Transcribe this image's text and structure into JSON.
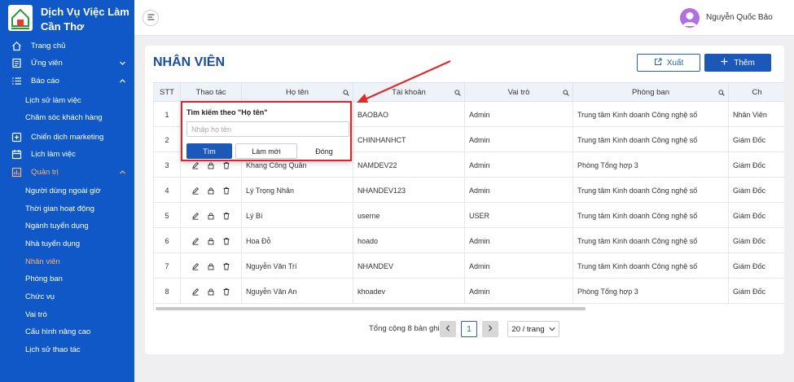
{
  "brand": {
    "name": "Dịch Vụ Việc Làm Cần Thơ"
  },
  "sidebar": {
    "items": [
      {
        "label": "Trang chủ",
        "icon": "home-icon"
      },
      {
        "label": "Ứng viên",
        "icon": "candidate-icon"
      },
      {
        "label": "Báo cáo",
        "icon": "list-icon"
      },
      {
        "label": "Lịch sử làm việc"
      },
      {
        "label": "Chăm sóc khách hàng"
      },
      {
        "label": "Chiến dịch marketing",
        "icon": "campaign-icon"
      },
      {
        "label": "Lịch làm việc",
        "icon": "calendar-icon"
      },
      {
        "label": "Quản trị",
        "icon": "admin-icon"
      },
      {
        "label": "Người dùng ngoài giờ"
      },
      {
        "label": "Thời gian hoạt động"
      },
      {
        "label": "Ngành tuyển dụng"
      },
      {
        "label": "Nhà tuyển dụng"
      },
      {
        "label": "Nhân viên"
      },
      {
        "label": "Phòng ban"
      },
      {
        "label": "Chức vụ"
      },
      {
        "label": "Vai trò"
      },
      {
        "label": "Cấu hình nâng cao"
      },
      {
        "label": "Lịch sử thao tác"
      }
    ]
  },
  "topbar": {
    "username": "Nguyễn Quốc Bảo"
  },
  "page": {
    "title": "NHÂN VIÊN",
    "export_label": "Xuất",
    "add_label": "Thêm"
  },
  "table": {
    "headers": [
      "STT",
      "Thao tác",
      "Họ tên",
      "Tài khoản",
      "Vai trò",
      "Phòng ban",
      "Ch"
    ],
    "rows": [
      {
        "stt": "1",
        "name": "",
        "account": "BAOBAO",
        "role": "Admin",
        "dept": "Trung tâm Kinh doanh Công nghệ số",
        "pos": "Nhân Viên"
      },
      {
        "stt": "2",
        "name": "",
        "account": "CHINHANHCT",
        "role": "Admin",
        "dept": "Trung tâm Kinh doanh Công nghệ số",
        "pos": "Giám Đốc"
      },
      {
        "stt": "3",
        "name": "Khang Công Quân",
        "account": "NAMDEV22",
        "role": "Admin",
        "dept": "Phòng Tổng hợp 3",
        "pos": "Giám Đốc"
      },
      {
        "stt": "4",
        "name": "Lý Trọng Nhân",
        "account": "NHANDEV123",
        "role": "Admin",
        "dept": "Trung tâm Kinh doanh Công nghệ số",
        "pos": "Giám Đốc"
      },
      {
        "stt": "5",
        "name": "Lý Bí",
        "account": "userne",
        "role": "USER",
        "dept": "Trung tâm Kinh doanh Công nghệ số",
        "pos": "Giám Đốc"
      },
      {
        "stt": "6",
        "name": "Hoa Đỗ",
        "account": "hoado",
        "role": "Admin",
        "dept": "Trung tâm Kinh doanh Công nghệ số",
        "pos": "Giám Đốc"
      },
      {
        "stt": "7",
        "name": "Nguyễn Văn Trí",
        "account": "NHANDEV",
        "role": "Admin",
        "dept": "Trung tâm Kinh doanh Công nghệ số",
        "pos": "Giám Đốc"
      },
      {
        "stt": "8",
        "name": "Nguyễn Văn An",
        "account": "khoadev",
        "role": "Admin",
        "dept": "Phòng Tổng hợp 3",
        "pos": "Giám Đốc"
      }
    ]
  },
  "pagination": {
    "total_text": "Tổng cộng 8 bản ghi",
    "current_page": "1",
    "page_size": "20 / trang"
  },
  "search_popup": {
    "title": "Tìm kiếm theo \"Họ tên\"",
    "placeholder": "Nhập họ tên",
    "search_label": "Tìm",
    "reset_label": "Làm mới",
    "close_label": "Đóng"
  },
  "colors": {
    "sidebar_bg": "#1058c7",
    "active": "#ffb169",
    "primary": "#1b58b8",
    "highlight": "#d9252b"
  }
}
